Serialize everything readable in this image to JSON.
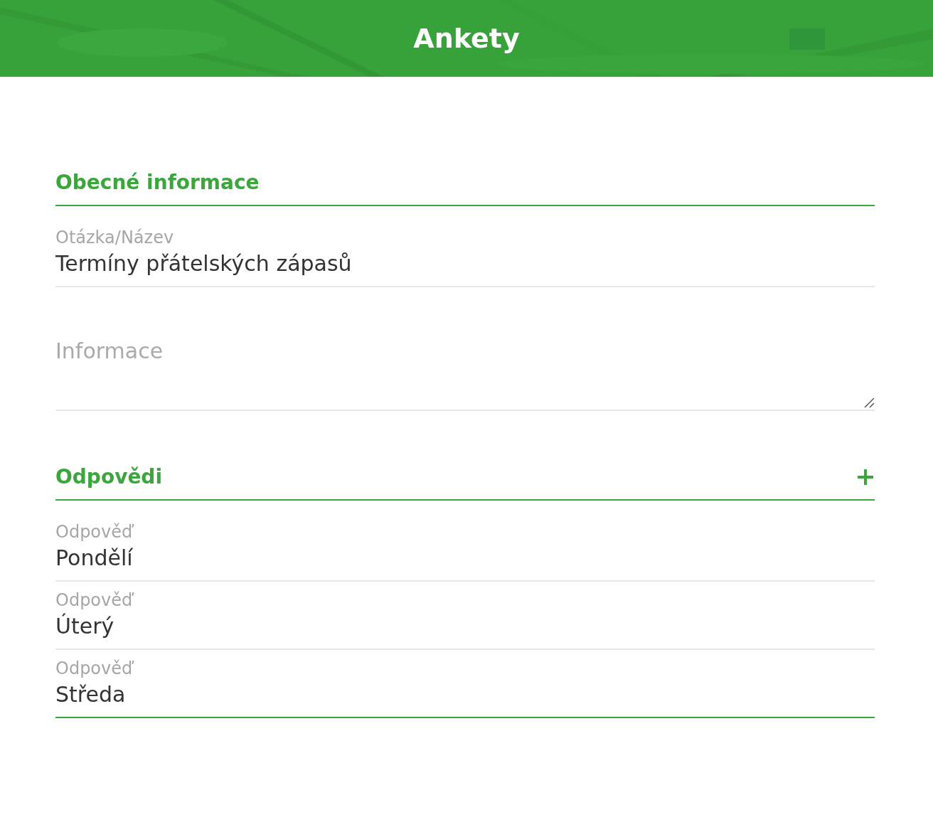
{
  "header": {
    "title": "Ankety"
  },
  "general": {
    "heading": "Obecné informace",
    "question": {
      "label": "Otázka/Název",
      "value": "Termíny přátelských zápasů",
      "focused": false
    },
    "info": {
      "placeholder": "Informace"
    }
  },
  "answers": {
    "heading": "Odpovědi",
    "items": [
      {
        "label": "Odpověď",
        "value": "Pondělí",
        "focused": false
      },
      {
        "label": "Odpověď",
        "value": "Úterý",
        "focused": false
      },
      {
        "label": "Odpověď",
        "value": "Středa",
        "focused": true
      }
    ]
  }
}
